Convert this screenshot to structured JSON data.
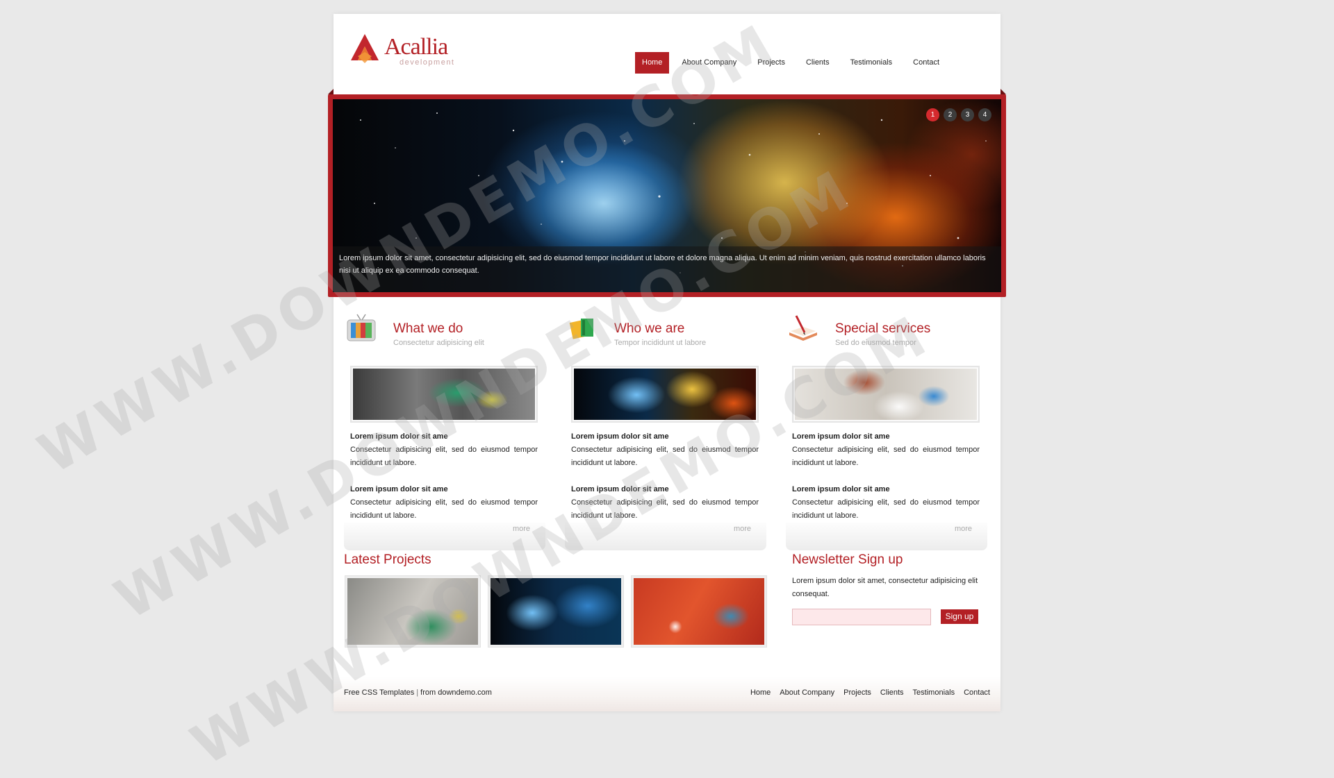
{
  "brand": {
    "name": "Acallia",
    "tagline": "development"
  },
  "nav": [
    {
      "label": "Home",
      "active": true
    },
    {
      "label": "About Company"
    },
    {
      "label": "Projects"
    },
    {
      "label": "Clients"
    },
    {
      "label": "Testimonials"
    },
    {
      "label": "Contact"
    }
  ],
  "slider": {
    "pages": [
      "1",
      "2",
      "3",
      "4"
    ],
    "active_page": "1",
    "caption": "Lorem ipsum dolor sit amet, consectetur adipisicing elit, sed do eiusmod tempor incididunt ut labore et dolore magna aliqua. Ut enim ad minim veniam, quis nostrud exercitation ullamco laboris nisi ut aliquip ex ea commodo consequat."
  },
  "columns": [
    {
      "icon": "tv-icon",
      "title": "What we do",
      "subtitle": "Consectetur adipisicing elit",
      "items": [
        {
          "heading": "Lorem ipsum dolor sit ame",
          "text": "Consectetur adipisicing elit, sed do eiusmod tempor incididunt ut labore."
        },
        {
          "heading": "Lorem ipsum dolor sit ame",
          "text": "Consectetur adipisicing elit, sed do eiusmod tempor incididunt ut labore."
        }
      ],
      "more": "more"
    },
    {
      "icon": "books-icon",
      "title": "Who we are",
      "subtitle": "Tempor incididunt ut labore",
      "items": [
        {
          "heading": "Lorem ipsum dolor sit ame",
          "text": "Consectetur adipisicing elit, sed do eiusmod tempor incididunt ut labore."
        },
        {
          "heading": "Lorem ipsum dolor sit ame",
          "text": "Consectetur adipisicing elit, sed do eiusmod tempor incididunt ut labore."
        }
      ],
      "more": "more"
    },
    {
      "icon": "book-pen-icon",
      "title": "Special services",
      "subtitle": "Sed do eiusmod tempor",
      "items": [
        {
          "heading": "Lorem ipsum dolor sit ame",
          "text": "Consectetur adipisicing elit, sed do eiusmod tempor incididunt ut labore."
        },
        {
          "heading": "Lorem ipsum dolor sit ame",
          "text": "Consectetur adipisicing elit, sed do eiusmod tempor incididunt ut labore."
        }
      ],
      "more": "more"
    }
  ],
  "latest_projects": {
    "title": "Latest Projects"
  },
  "newsletter": {
    "title": "Newsletter Sign up",
    "text": "Lorem ipsum dolor sit amet, consectetur adipisicing elit consequat.",
    "input_value": "",
    "button": "Sign up"
  },
  "footer": {
    "left_link": "Free CSS Templates",
    "separator": "|",
    "from_text": "from downdemo.com",
    "nav": [
      "Home",
      "About Company",
      "Projects",
      "Clients",
      "Testimonials",
      "Contact"
    ]
  },
  "watermark": "WWW.DOWNDEMO.COM",
  "colors": {
    "accent": "#b32025",
    "background": "#e9e9e9",
    "newsletter_input": "#fde8ea"
  }
}
